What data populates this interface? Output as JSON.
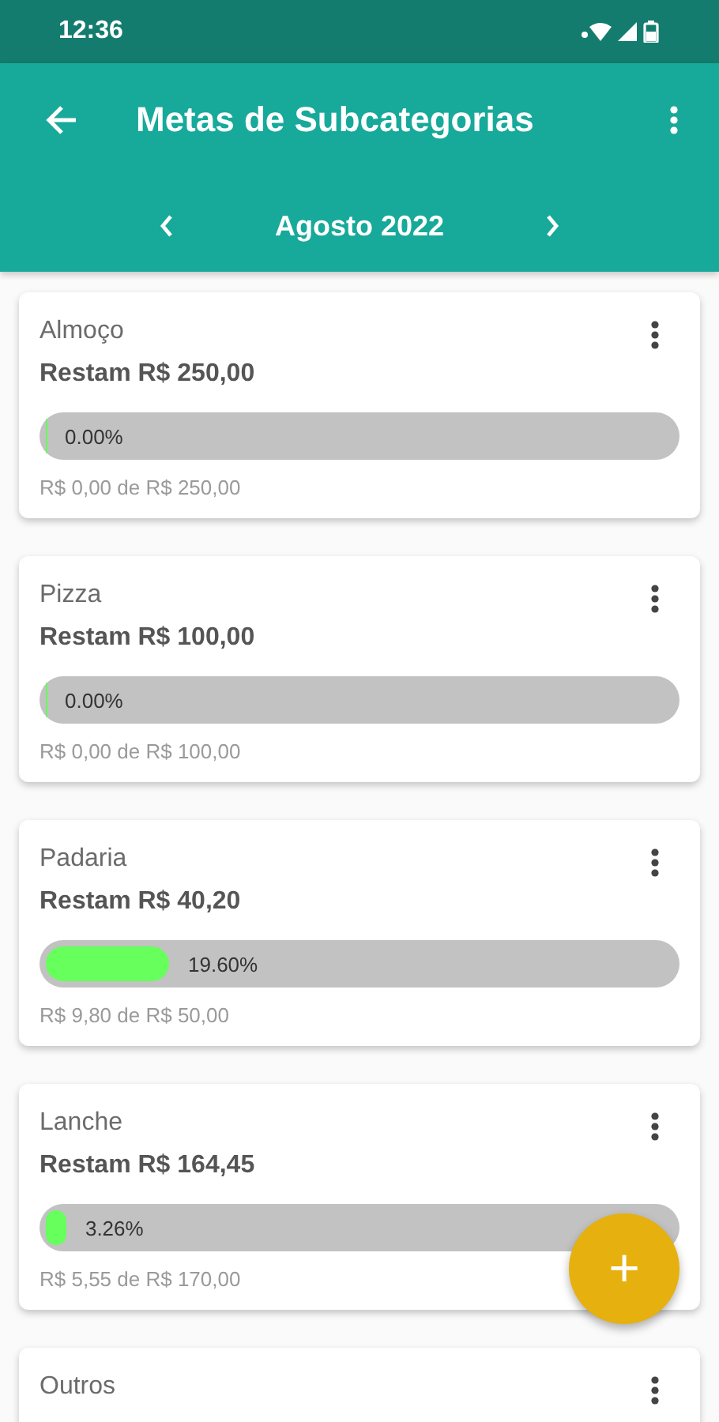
{
  "status_bar": {
    "time": "12:36"
  },
  "app_bar": {
    "title": "Metas de Subcategorias"
  },
  "month_nav": {
    "label": "Agosto 2022"
  },
  "goals": [
    {
      "name": "Almoço",
      "remaining": "Restam R$ 250,00",
      "level": 0,
      "percent": "0.00%",
      "spent": "R$ 0,00 de R$ 250,00"
    },
    {
      "name": "Pizza",
      "remaining": "Restam R$ 100,00",
      "level": 0,
      "percent": "0.00%",
      "spent": "R$ 0,00 de R$ 100,00"
    },
    {
      "name": "Padaria",
      "remaining": "Restam R$ 40,20",
      "level": 0.196,
      "percent": "19.60%",
      "spent": "R$ 9,80 de R$ 50,00"
    },
    {
      "name": "Lanche",
      "remaining": "Restam R$ 164,45",
      "level": 0.0326,
      "percent": "3.26%",
      "spent": "R$ 5,55 de R$ 170,00"
    },
    {
      "name": "Outros"
    }
  ],
  "fab": {
    "label": "+"
  }
}
